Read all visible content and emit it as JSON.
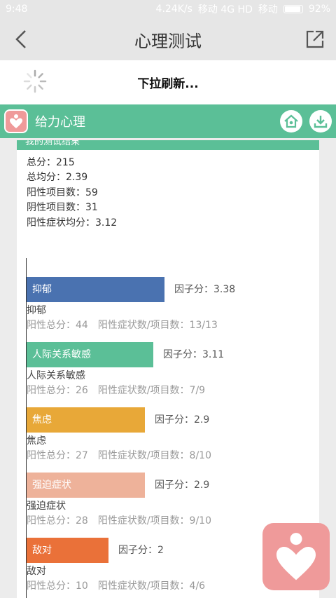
{
  "status": {
    "time": "9:48",
    "speed": "4.24K/s",
    "carrier1": "移动 4G HD",
    "carrier2": "移动",
    "battery": "92%"
  },
  "header": {
    "title": "心理测试"
  },
  "refresh": {
    "text": "下拉刷新..."
  },
  "brand": {
    "name": "给力心理"
  },
  "card": {
    "header_text": "我的测试结果"
  },
  "summary": [
    "总分：215",
    "总均分：2.39",
    "阳性项目数：59",
    "阴性项目数：31",
    "阳性症状均分：3.12"
  ],
  "colors": {
    "accent": "#5bbf97",
    "logo": "#ef9a9a"
  },
  "chart_data": {
    "type": "bar",
    "orientation": "horizontal",
    "value_label": "因子分",
    "categories": [
      "抑郁",
      "人际关系敏感",
      "焦虑",
      "强迫症状",
      "敌对"
    ],
    "values": [
      3.38,
      3.11,
      2.9,
      2.9,
      2
    ],
    "value_texts": [
      "因子分：3.38",
      "因子分：3.11",
      "因子分：2.9",
      "因子分：2.9",
      "因子分：2"
    ],
    "stats_total": [
      "阳性总分：44",
      "阳性总分：26",
      "阳性总分：27",
      "阳性总分：28",
      "阳性总分：10"
    ],
    "stats_ratio": [
      "阳性症状数/项目数：13/13",
      "阳性症状数/项目数：7/9",
      "阳性症状数/项目数：8/10",
      "阳性症状数/项目数：9/10",
      "阳性症状数/项目数：4/6"
    ],
    "colors": [
      "#4a72b0",
      "#5bbf97",
      "#e8a838",
      "#eeb29a",
      "#ea7139"
    ]
  }
}
